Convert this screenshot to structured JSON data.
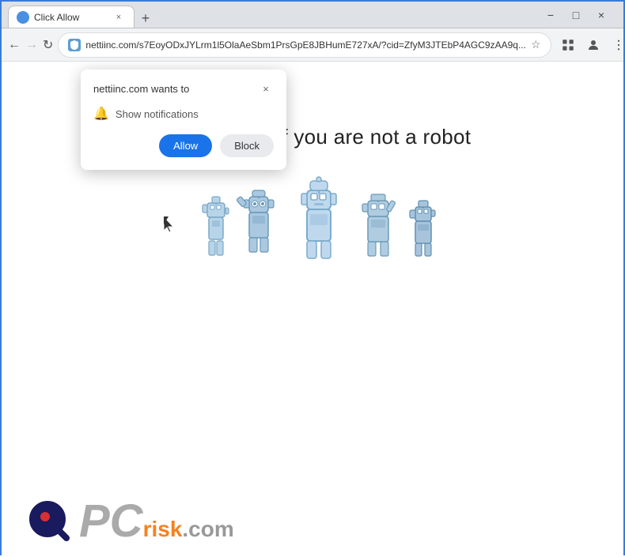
{
  "window": {
    "title": "Click Allow",
    "tab_title": "Click Allow"
  },
  "titlebar": {
    "minimize_label": "−",
    "maximize_label": "□",
    "close_label": "×"
  },
  "navigation": {
    "back_label": "←",
    "forward_label": "→",
    "refresh_label": "↻",
    "address": "nettiinc.com/s7EoyODxJYLrm1l5OlaAeSbm1PrsGpE8JBHumE727xA/?cid=ZfyM3JTEbP4AGC9zAA9q...",
    "star_label": "☆",
    "extensions_label": "⊞",
    "profile_label": "👤",
    "menu_label": "⋮"
  },
  "popup": {
    "title": "nettiinc.com wants to",
    "close_label": "×",
    "notification_text": "Show notifications",
    "allow_label": "Allow",
    "block_label": "Block"
  },
  "page": {
    "headline": "Click \"Allow\"   if you are not   a robot"
  },
  "footer": {
    "logo_pc": "PC",
    "logo_risk": "risk",
    "logo_com": ".com"
  }
}
